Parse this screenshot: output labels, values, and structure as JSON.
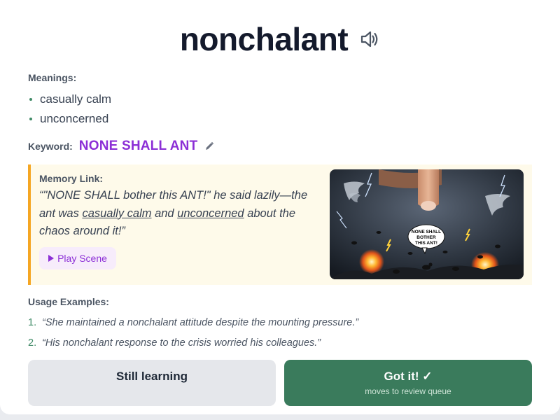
{
  "word": "nonchalant",
  "meanings_label": "Meanings:",
  "meanings": [
    "casually calm",
    "unconcerned"
  ],
  "keyword": {
    "label": "Keyword:",
    "value": "NONE SHALL ANT"
  },
  "memory": {
    "label": "Memory Link:",
    "text_before_1": "“\"NONE SHALL bother this ANT!\" he said lazily—the ant was ",
    "highlight_1": "casually calm",
    "text_between": " and ",
    "highlight_2": "unconcerned",
    "text_after": " about the chaos around it!”",
    "play_label": "Play Scene",
    "scene_bubble_lines": [
      "NONE SHALL",
      "BOTHER",
      "THIS ANT!"
    ]
  },
  "usage": {
    "label": "Usage Examples:",
    "examples": [
      {
        "num": "1.",
        "text": "“She maintained a nonchalant attitude despite the mounting pressure.”"
      },
      {
        "num": "2.",
        "text": "“His nonchalant response to the crisis worried his colleagues.”"
      }
    ]
  },
  "actions": {
    "learning_label": "Still learning",
    "got_label": "Got it! ✓",
    "got_sub": "moves to review queue"
  },
  "icons": {
    "speaker": "speaker-icon",
    "pencil": "pencil-icon",
    "play": "play-icon"
  },
  "colors": {
    "accent_purple": "#8c2fd6",
    "success_green": "#3a7b5c",
    "memory_border": "#f5a623",
    "memory_bg": "#fefaea"
  }
}
